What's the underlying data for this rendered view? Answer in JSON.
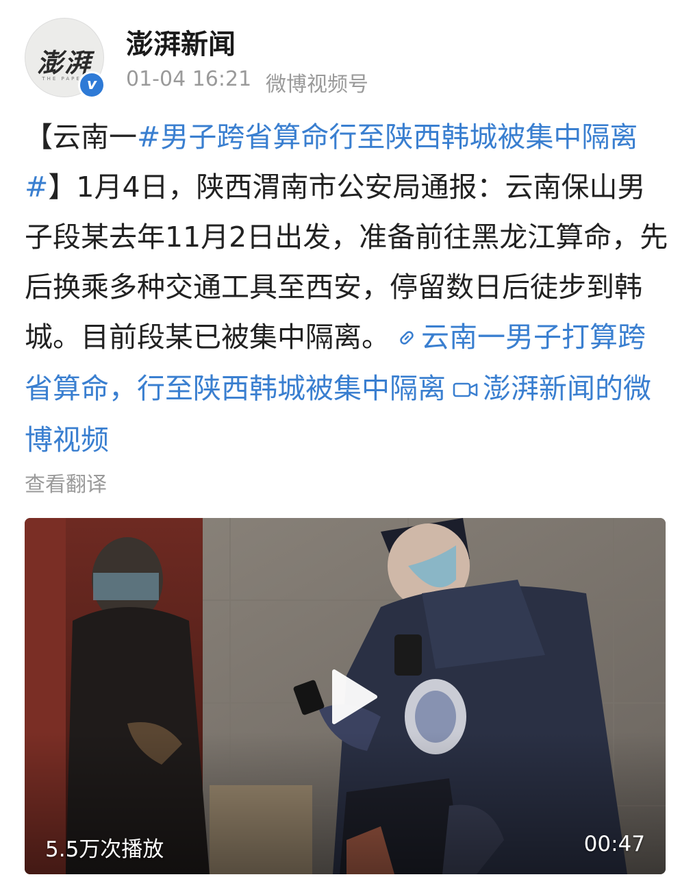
{
  "header": {
    "avatar_text": "澎湃",
    "avatar_subtext": "THE PAPER",
    "verified_mark": "v",
    "account_name": "澎湃新闻",
    "time": "01-04 16:21",
    "source": "微博视频号"
  },
  "post": {
    "open_bracket": "【云南一",
    "hashtag": "#男子跨省算命行至陕西韩城被集中隔离#",
    "close_bracket_and_text": "】1月4日，陕西渭南市公安局通报：云南保山男子段某去年11月2日出发，准备前往黑龙江算命，先后换乘多种交通工具至西安，停留数日后徒步到韩城。目前段某已被集中隔离。",
    "link_text": "云南一男子打算跨省算命，行至陕西韩城被集中隔离",
    "video_link_text": "澎湃新闻的微博视频",
    "translate": "查看翻译"
  },
  "video": {
    "play_count": "5.5万次播放",
    "duration": "00:47"
  },
  "colors": {
    "link_blue": "#3a7fd0",
    "meta_gray": "#9a9a9a",
    "verified_blue": "#2e7ad6"
  }
}
